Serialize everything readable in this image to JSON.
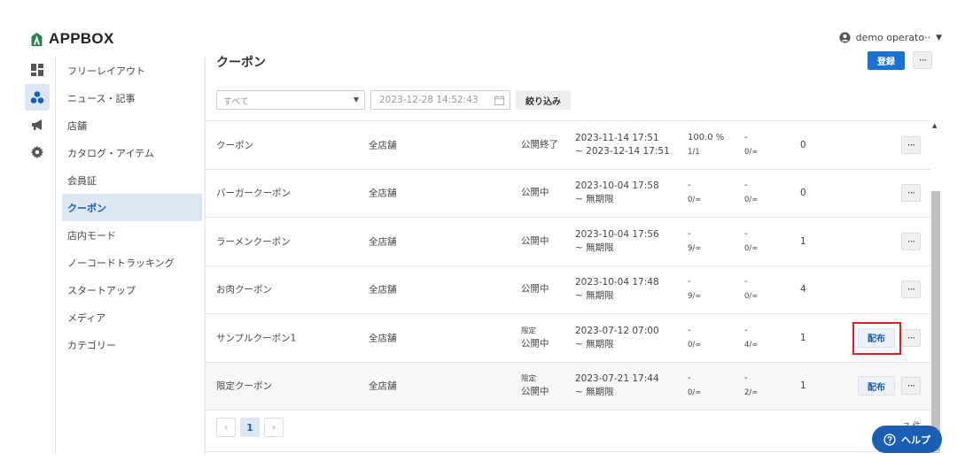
{
  "app": {
    "name": "APPBOX"
  },
  "user": {
    "name": "demo operato··"
  },
  "sidebar": {
    "items": [
      {
        "label": "フリーレイアウト"
      },
      {
        "label": "ニュース・記事"
      },
      {
        "label": "店舗"
      },
      {
        "label": "カタログ・アイテム"
      },
      {
        "label": "会員証"
      },
      {
        "label": "クーポン",
        "active": true
      },
      {
        "label": "店内モード"
      },
      {
        "label": "ノーコードトラッキング"
      },
      {
        "label": "スタートアップ"
      },
      {
        "label": "メディア"
      },
      {
        "label": "カテゴリー"
      }
    ]
  },
  "page": {
    "title": "クーポン",
    "register_label": "登録",
    "more_label": "···"
  },
  "filter": {
    "select_value": "すべて",
    "date_placeholder": "2023-12-28 14:52:43",
    "apply_label": "絞り込み"
  },
  "table": {
    "distribute_label": "配布",
    "more_label": "···",
    "rows": [
      {
        "name": "クーポン",
        "store": "全店舗",
        "status_top": "",
        "status": "公開終了",
        "date_start": "2023-11-14 17:51",
        "date_end": "~ 2023-12-14 17:51",
        "rate": "100.0 %",
        "rate_sub": "1/1",
        "cnt": "-",
        "cnt_sub": "0/∞",
        "num": "0"
      },
      {
        "name": "バーガークーポン",
        "store": "全店舗",
        "status_top": "",
        "status": "公開中",
        "date_start": "2023-10-04 17:58",
        "date_end": "~ 無期限",
        "rate": "-",
        "rate_sub": "0/∞",
        "cnt": "-",
        "cnt_sub": "0/∞",
        "num": "0"
      },
      {
        "name": "ラーメンクーポン",
        "store": "全店舗",
        "status_top": "",
        "status": "公開中",
        "date_start": "2023-10-04 17:56",
        "date_end": "~ 無期限",
        "rate": "-",
        "rate_sub": "9/∞",
        "cnt": "-",
        "cnt_sub": "0/∞",
        "num": "1"
      },
      {
        "name": "お肉クーポン",
        "store": "全店舗",
        "status_top": "",
        "status": "公開中",
        "date_start": "2023-10-04 17:48",
        "date_end": "~ 無期限",
        "rate": "-",
        "rate_sub": "9/∞",
        "cnt": "-",
        "cnt_sub": "0/∞",
        "num": "4"
      },
      {
        "name": "サンプルクーポン1",
        "store": "全店舗",
        "status_top": "限定",
        "status": "公開中",
        "date_start": "2023-07-12 07:00",
        "date_end": "~ 無期限",
        "rate": "-",
        "rate_sub": "0/∞",
        "cnt": "-",
        "cnt_sub": "4/∞",
        "num": "1"
      },
      {
        "name": "限定クーポン",
        "store": "全店舗",
        "status_top": "限定",
        "status": "公開中",
        "date_start": "2023-07-21 17:44",
        "date_end": "~ 無期限",
        "rate": "-",
        "rate_sub": "0/∞",
        "cnt": "-",
        "cnt_sub": "2/∞",
        "num": "1"
      }
    ]
  },
  "pagination": {
    "prev": "‹",
    "current": "1",
    "next": "›",
    "total": "7 件"
  },
  "help": {
    "label": "ヘルプ"
  },
  "colors": {
    "accent": "#1a73d4",
    "active_bg": "#dde7f3",
    "highlight": "#e02020"
  }
}
